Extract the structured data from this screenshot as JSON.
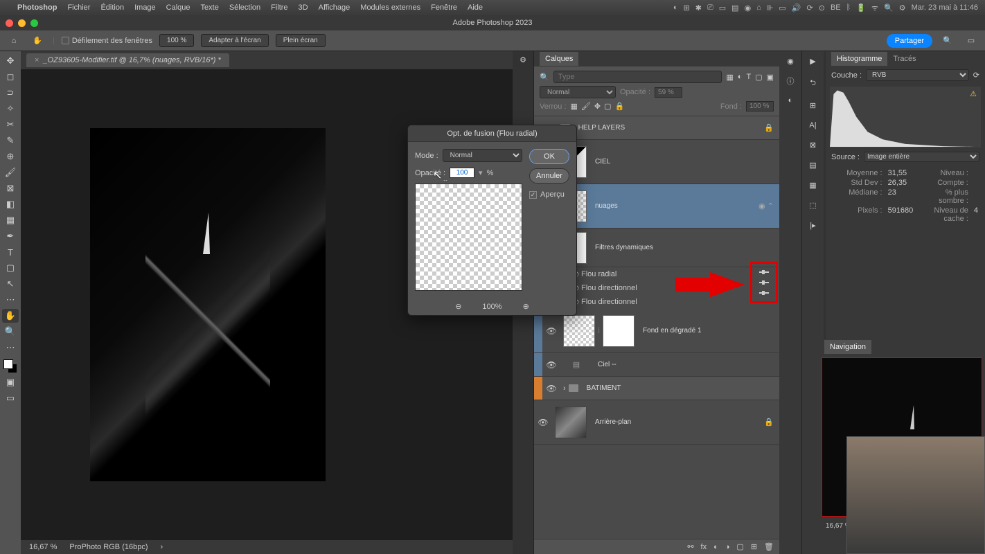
{
  "menubar": {
    "items": [
      "Photoshop",
      "Fichier",
      "Édition",
      "Image",
      "Calque",
      "Texte",
      "Sélection",
      "Filtre",
      "3D",
      "Affichage",
      "Modules externes",
      "Fenêtre",
      "Aide"
    ],
    "clock": "Mar. 23 mai à 11:46"
  },
  "window_title": "Adobe Photoshop 2023",
  "optionsbar": {
    "scroll": "Défilement des fenêtres",
    "zoom": "100 %",
    "fit": "Adapter à l'écran",
    "full": "Plein écran",
    "share": "Partager"
  },
  "document": {
    "tab": "_OZ93605-Modifier.tif @ 16,7% (nuages, RVB/16*) *",
    "status_zoom": "16,67 %",
    "status_profile": "ProPhoto RGB (16bpc)"
  },
  "dialog": {
    "title": "Opt. de fusion (Flou radial)",
    "mode_label": "Mode :",
    "mode_value": "Normal",
    "opacity_label": "Opacité :",
    "opacity_value": "100",
    "percent": "%",
    "ok": "OK",
    "cancel": "Annuler",
    "preview": "Aperçu",
    "zoom": "100%"
  },
  "layers": {
    "panel_title": "Calques",
    "type_label": "Type",
    "blend_mode": "Normal",
    "opacity_label": "Opacité :",
    "opacity_value": "59 %",
    "lock_label": "Verrou :",
    "fill_label": "Fond :",
    "fill_value": "100 %",
    "groups": {
      "help": "HELP LAYERS",
      "batiment": "BATIMENT"
    },
    "items": {
      "ciel": "CIEL",
      "nuages": "nuages",
      "filters": "Filtres dynamiques",
      "flou_radial": "Flou radial",
      "flou_dir1": "Flou directionnel",
      "flou_dir2": "Flou directionnel",
      "gradient": "Fond en dégradé 1",
      "ciel2": "Ciel --",
      "arriere": "Arrière-plan"
    }
  },
  "histogram": {
    "title": "Histogramme",
    "traces": "Tracés",
    "channel_label": "Couche :",
    "channel_value": "RVB",
    "source_label": "Source :",
    "source_value": "Image entière",
    "stats": {
      "moyenne_l": "Moyenne :",
      "moyenne_v": "31,55",
      "niveau_l": "Niveau :",
      "stddev_l": "Std Dev :",
      "stddev_v": "26,35",
      "compte_l": "Compte :",
      "mediane_l": "Médiane :",
      "mediane_v": "23",
      "sombre_l": "% plus sombre :",
      "pixels_l": "Pixels :",
      "pixels_v": "591680",
      "cache_l": "Niveau de cache :",
      "cache_v": "4"
    }
  },
  "navigation": {
    "title": "Navigation",
    "zoom": "16,67 %"
  }
}
